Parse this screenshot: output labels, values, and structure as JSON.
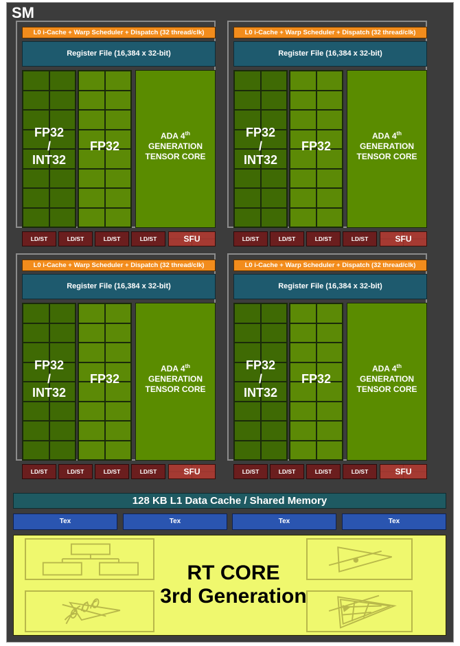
{
  "sm": {
    "title": "SM",
    "partitions": [
      {
        "l0_label": "L0 i-Cache + Warp Scheduler + Dispatch (32 thread/clk)",
        "register_file": "Register File (16,384 x 32-bit)",
        "fp32_int32": [
          "FP32",
          "/",
          "INT32"
        ],
        "fp32": "FP32",
        "tensor": {
          "line1": "ADA 4",
          "sup": "th",
          "line2": "GENERATION",
          "line3": "TENSOR CORE"
        },
        "ldst": [
          "LD/ST",
          "LD/ST",
          "LD/ST",
          "LD/ST"
        ],
        "sfu": "SFU"
      },
      {
        "l0_label": "L0 i-Cache + Warp Scheduler + Dispatch (32 thread/clk)",
        "register_file": "Register File (16,384 x 32-bit)",
        "fp32_int32": [
          "FP32",
          "/",
          "INT32"
        ],
        "fp32": "FP32",
        "tensor": {
          "line1": "ADA 4",
          "sup": "th",
          "line2": "GENERATION",
          "line3": "TENSOR CORE"
        },
        "ldst": [
          "LD/ST",
          "LD/ST",
          "LD/ST",
          "LD/ST"
        ],
        "sfu": "SFU"
      },
      {
        "l0_label": "L0 i-Cache + Warp Scheduler + Dispatch (32 thread/clk)",
        "register_file": "Register File (16,384 x 32-bit)",
        "fp32_int32": [
          "FP32",
          "/",
          "INT32"
        ],
        "fp32": "FP32",
        "tensor": {
          "line1": "ADA 4",
          "sup": "th",
          "line2": "GENERATION",
          "line3": "TENSOR CORE"
        },
        "ldst": [
          "LD/ST",
          "LD/ST",
          "LD/ST",
          "LD/ST"
        ],
        "sfu": "SFU"
      },
      {
        "l0_label": "L0 i-Cache + Warp Scheduler + Dispatch (32 thread/clk)",
        "register_file": "Register File (16,384 x 32-bit)",
        "fp32_int32": [
          "FP32",
          "/",
          "INT32"
        ],
        "fp32": "FP32",
        "tensor": {
          "line1": "ADA 4",
          "sup": "th",
          "line2": "GENERATION",
          "line3": "TENSOR CORE"
        },
        "ldst": [
          "LD/ST",
          "LD/ST",
          "LD/ST",
          "LD/ST"
        ],
        "sfu": "SFU"
      }
    ],
    "l1_cache": "128 KB L1 Data Cache / Shared Memory",
    "tex_units": [
      "Tex",
      "Tex",
      "Tex",
      "Tex"
    ],
    "rt_core": {
      "line1": "RT CORE",
      "line2": "3rd Generation",
      "icons": [
        "bvh-tree-icon",
        "ray-triangle-intersection-icon",
        "alpha-traversal-icon",
        "displaced-micro-mesh-icon"
      ]
    },
    "colors": {
      "background": "#3c3c3c",
      "l0": "#f28c1c",
      "register_file": "#1e5a6e",
      "fp32_int32": "#3f6a04",
      "fp32": "#5c8a06",
      "tensor": "#5a8c00",
      "ldst": "#6b1e1e",
      "sfu": "#a53a32",
      "l1": "#1e5a62",
      "tex": "#2a55b0",
      "rt_core": "#eff86e"
    }
  }
}
